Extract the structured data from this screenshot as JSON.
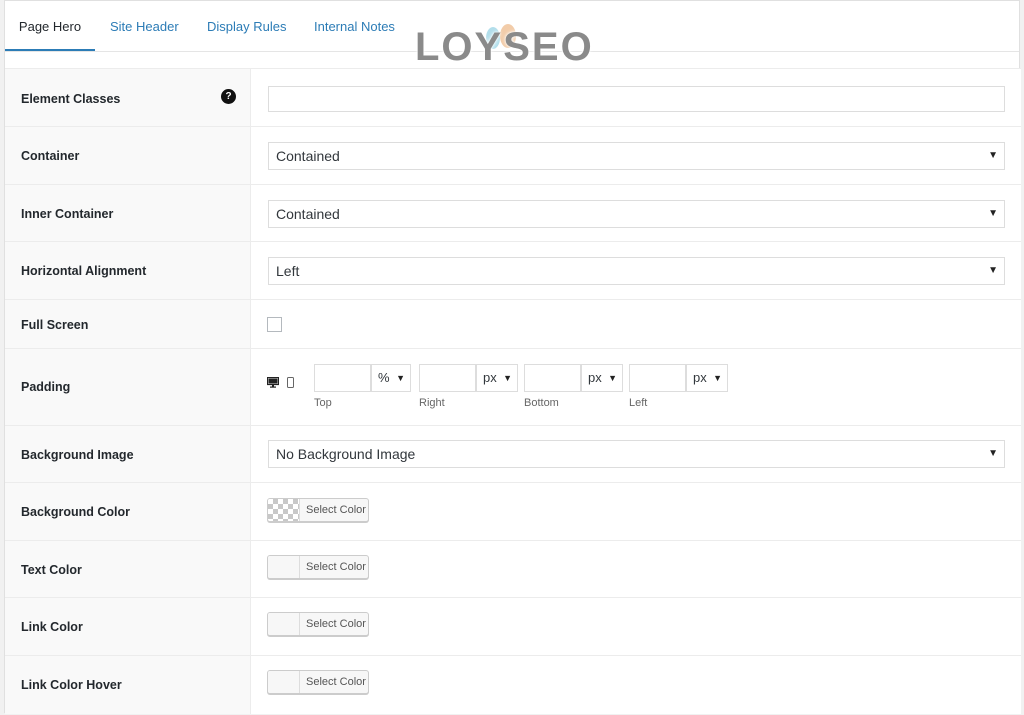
{
  "tabs": [
    "Page Hero",
    "Site Header",
    "Display Rules",
    "Internal Notes"
  ],
  "logo_text": "LOYSEO",
  "fields": {
    "element_classes": {
      "label": "Element Classes",
      "help": "?",
      "value": ""
    },
    "container": {
      "label": "Container",
      "value": "Contained"
    },
    "inner_container": {
      "label": "Inner Container",
      "value": "Contained"
    },
    "horizontal_alignment": {
      "label": "Horizontal Alignment",
      "value": "Left"
    },
    "full_screen": {
      "label": "Full Screen",
      "checked": false
    },
    "padding": {
      "label": "Padding",
      "sides": [
        {
          "label": "Top",
          "value": "",
          "unit": "%"
        },
        {
          "label": "Right",
          "value": "",
          "unit": "px"
        },
        {
          "label": "Bottom",
          "value": "",
          "unit": "px"
        },
        {
          "label": "Left",
          "value": "",
          "unit": "px"
        }
      ]
    },
    "background_image": {
      "label": "Background Image",
      "value": "No Background Image"
    },
    "background_color": {
      "label": "Background Color",
      "button": "Select Color"
    },
    "text_color": {
      "label": "Text Color",
      "button": "Select Color"
    },
    "link_color": {
      "label": "Link Color",
      "button": "Select Color"
    },
    "link_color_hover": {
      "label": "Link Color Hover",
      "button": "Select Color"
    }
  },
  "icons": {
    "help": "question-circle",
    "desktop": "desktop-icon",
    "mobile": "mobile-icon",
    "dropdown": "chevron-down-icon"
  },
  "colors": {
    "link": "#2c7cb6",
    "label_bg": "#f9f9f9"
  }
}
